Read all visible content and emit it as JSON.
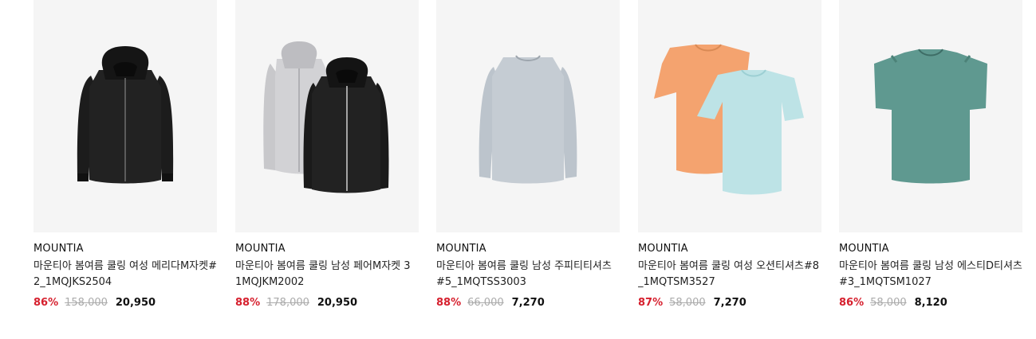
{
  "products": [
    {
      "brand": "MOUNTIA",
      "name": "마운티아 봄여름 쿨링 여성 메리다M자켓#2_1MQJKS2504",
      "discount": "86%",
      "original_price": "158,000",
      "sale_price": "20,950",
      "image": "black-hooded-jacket"
    },
    {
      "brand": "MOUNTIA",
      "name": "마운티아 봄여름 쿨링 남성 페어M자켓 3 1MQJKM2002",
      "discount": "88%",
      "original_price": "178,000",
      "sale_price": "20,950",
      "image": "gray-and-black-hooded-jackets"
    },
    {
      "brand": "MOUNTIA",
      "name": "마운티아 봄여름 쿨링 남성 주피티티셔츠#5_1MQTSS3003",
      "discount": "88%",
      "original_price": "66,000",
      "sale_price": "7,270",
      "image": "light-blue-long-sleeve-tee"
    },
    {
      "brand": "MOUNTIA",
      "name": "마운티아 봄여름 쿨링 여성 오션티셔츠#8_1MQTSM3527",
      "discount": "87%",
      "original_price": "58,000",
      "sale_price": "7,270",
      "image": "orange-and-mint-tees"
    },
    {
      "brand": "MOUNTIA",
      "name": "마운티아 봄여름 쿨링 남성 에스티D티셔츠#3_1MQTSM1027",
      "discount": "86%",
      "original_price": "58,000",
      "sale_price": "8,120",
      "image": "teal-heather-tee"
    }
  ]
}
